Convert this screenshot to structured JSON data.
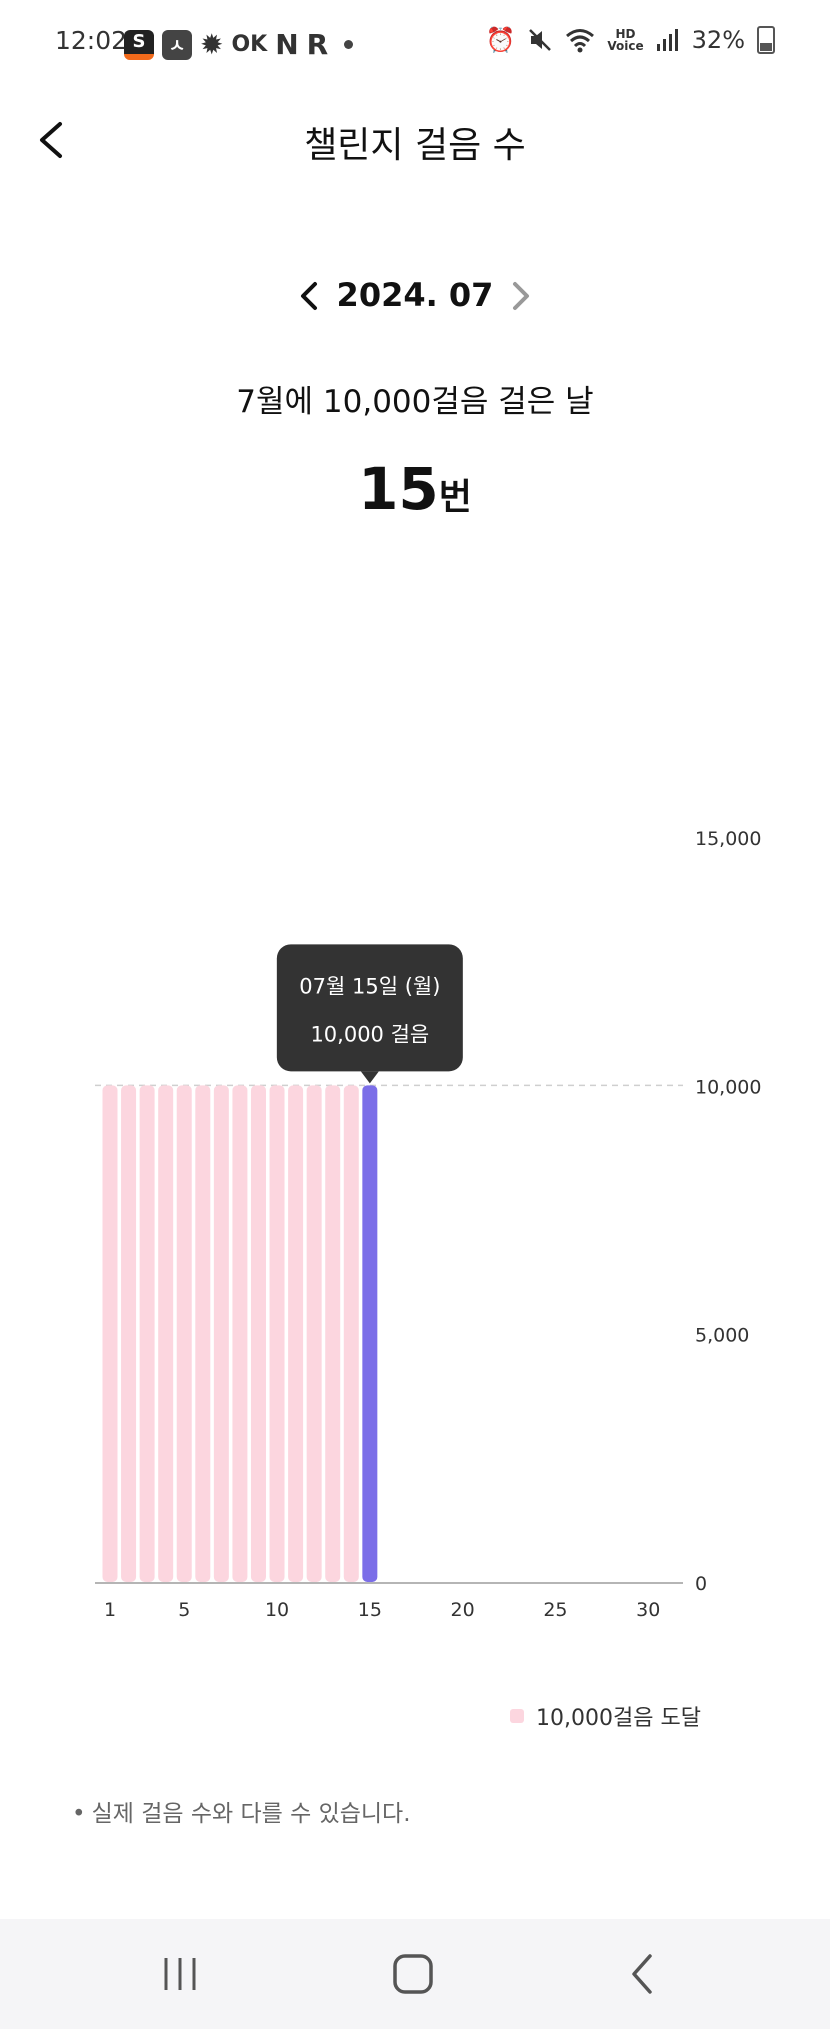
{
  "status_bar": {
    "time": "12:02",
    "left_icons": [
      "s-app-icon",
      "ye-app-icon",
      "gear-badge-icon",
      "ok-icon",
      "n-icon",
      "r-icon",
      "more-dot-icon"
    ],
    "left_texts": {
      "s": "S",
      "ye": "ㅅ",
      "ok": "OK",
      "n": "N",
      "r": "R"
    },
    "right_icons": [
      "alarm-icon",
      "mute-icon",
      "wifi-icon",
      "hd-voice-icon",
      "signal-icon",
      "battery-icon"
    ],
    "hd_label_top": "HD",
    "hd_label_bottom": "Voice",
    "battery": "32%"
  },
  "header": {
    "title": "챌린지 걸음 수"
  },
  "month_nav": {
    "label": "2024. 07"
  },
  "summary": {
    "text": "7월에 10,000걸음 걸은 날",
    "count": "15",
    "unit": "번"
  },
  "chart_data": {
    "type": "bar",
    "x_tick_labels": [
      "1",
      "5",
      "10",
      "15",
      "20",
      "25",
      "30"
    ],
    "y_tick_labels": [
      "0",
      "5,000",
      "10,000",
      "15,000"
    ],
    "days": [
      1,
      2,
      3,
      4,
      5,
      6,
      7,
      8,
      9,
      10,
      11,
      12,
      13,
      14,
      15,
      16,
      17,
      18,
      19,
      20,
      21,
      22,
      23,
      24,
      25,
      26,
      27,
      28,
      29,
      30,
      31
    ],
    "values": [
      10000,
      10000,
      10000,
      10000,
      10000,
      10000,
      10000,
      10000,
      10000,
      10000,
      10000,
      10000,
      10000,
      10000,
      10000,
      0,
      0,
      0,
      0,
      0,
      0,
      0,
      0,
      0,
      0,
      0,
      0,
      0,
      0,
      0,
      0
    ],
    "ylim": [
      0,
      15000
    ],
    "goal_line": 10000,
    "selected_day": 15,
    "bar_color": "#fcd6df",
    "selected_color": "#7b6ee8",
    "tooltip": {
      "date": "07월 15일 (월)",
      "steps": "10,000 걸음"
    },
    "legend": "10,000걸음 도달"
  },
  "footnote": "실제 걸음 수와 다를 수 있습니다."
}
